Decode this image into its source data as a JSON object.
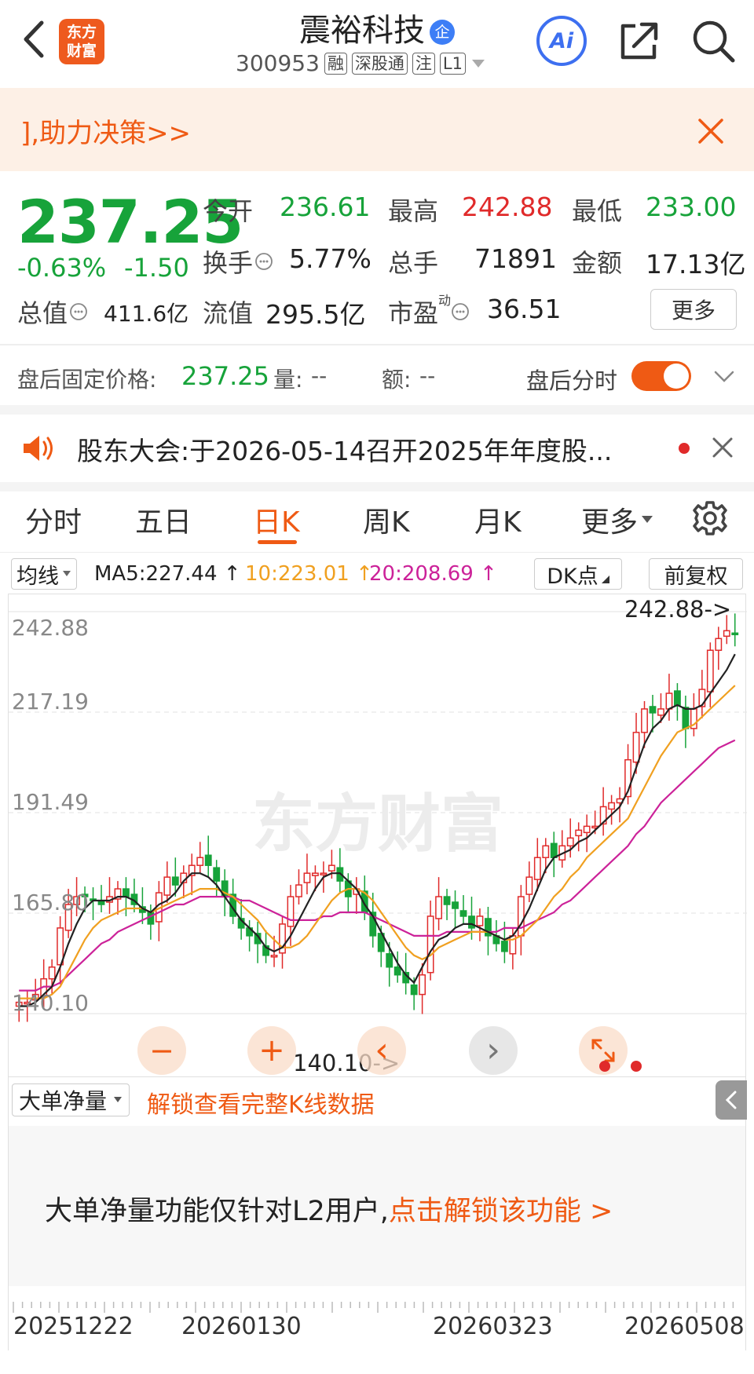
{
  "header": {
    "logo_text_line1": "东方",
    "logo_text_line2": "财富",
    "stock_name": "震裕科技",
    "name_badge": "企",
    "stock_code": "300953",
    "tags": [
      "融",
      "深股通",
      "注",
      "L1"
    ],
    "ai_label": "Ai"
  },
  "banner": {
    "text": "],助力决策>>"
  },
  "quote": {
    "price": "237.25",
    "change_pct": "-0.63%",
    "change_abs": "-1.50",
    "open_label": "今开",
    "open_value": "236.61",
    "high_label": "最高",
    "high_value": "242.88",
    "low_label": "最低",
    "low_value": "233.00",
    "turnover_label": "换手",
    "turnover_value": "5.77%",
    "volume_label": "总手",
    "volume_value": "71891",
    "amount_label": "金额",
    "amount_value": "17.13亿",
    "mktcap_label": "总值",
    "mktcap_value": "411.6亿",
    "float_label": "流值",
    "float_value": "295.5亿",
    "pe_label": "市盈",
    "pe_sup": "动",
    "pe_value": "36.51",
    "more_button": "更多"
  },
  "after_hours": {
    "label": "盘后固定价格:",
    "price": "237.25",
    "vol_label": "量:",
    "vol_value": "--",
    "amt_label": "额:",
    "amt_value": "--",
    "toggle_label": "盘后分时",
    "toggle_on": true
  },
  "notice": {
    "text": "股东大会:于2026-05-14召开2025年年度股..."
  },
  "tabs": {
    "items": [
      "分时",
      "五日",
      "日K",
      "周K",
      "月K",
      "更多"
    ],
    "active": "日K"
  },
  "ma_bar": {
    "dropdown": "均线",
    "ma5": "MA5:227.44 ↑",
    "ma10": "10:223.01 ↑",
    "ma20": "20:208.69 ↑",
    "dk_button": "DK点",
    "adjust_button": "前复权"
  },
  "colors": {
    "up": "#e02a2a",
    "down": "#17a33a",
    "ma5": "#222222",
    "ma10": "#f0a020",
    "ma20": "#cc2299",
    "accent": "#ef5a14"
  },
  "chart_data": {
    "type": "candlestick",
    "y_ticks": [
      "242.88",
      "217.19",
      "191.49",
      "165.80",
      "140.10"
    ],
    "ylim": [
      140.1,
      242.88
    ],
    "max_label": "242.88->",
    "min_label": "140.10->",
    "x_ticks": [
      "20251222",
      "20260130",
      "20260323",
      "20260508"
    ],
    "watermark": "东方财富",
    "close": [
      143,
      143,
      145,
      149,
      152,
      162,
      168,
      170,
      170,
      169,
      168,
      170,
      172,
      170,
      168,
      166,
      163,
      171,
      175,
      173,
      176,
      178,
      180,
      178,
      174,
      170,
      165,
      162,
      160,
      158,
      155,
      155,
      163,
      170,
      173,
      176,
      176,
      176,
      178,
      174,
      170,
      172,
      166,
      160,
      156,
      152,
      150,
      148,
      145,
      150,
      165,
      170,
      168,
      167,
      165,
      162,
      165,
      160,
      158,
      156,
      160,
      170,
      175,
      180,
      183,
      180,
      183,
      185,
      187,
      188,
      188,
      193,
      194,
      195,
      205,
      212,
      218,
      217,
      218,
      222,
      219,
      213,
      218,
      223,
      233,
      236,
      238,
      237
    ],
    "ma5": [
      142,
      142,
      143,
      145,
      147,
      152,
      158,
      163,
      167,
      169,
      169,
      169,
      170,
      170,
      169,
      167,
      166,
      168,
      169,
      171,
      174,
      176,
      176,
      175,
      173,
      170,
      167,
      164,
      162,
      160,
      157,
      156,
      157,
      160,
      164,
      168,
      172,
      175,
      176,
      176,
      174,
      172,
      168,
      165,
      161,
      157,
      153,
      150,
      148,
      152,
      156,
      159,
      160,
      162,
      163,
      163,
      162,
      161,
      160,
      159,
      160,
      163,
      167,
      172,
      177,
      180,
      181,
      182,
      184,
      185,
      187,
      189,
      191,
      193,
      197,
      203,
      209,
      213,
      215,
      218,
      219,
      218,
      218,
      219,
      222,
      225,
      228,
      232
    ],
    "ma10": [
      144,
      144,
      144,
      144,
      145,
      147,
      151,
      155,
      159,
      162,
      164,
      165,
      166,
      167,
      167,
      167,
      166,
      167,
      168,
      169,
      170,
      171,
      172,
      172,
      172,
      171,
      170,
      168,
      166,
      164,
      161,
      159,
      157,
      157,
      158,
      160,
      163,
      166,
      169,
      171,
      172,
      172,
      171,
      169,
      166,
      163,
      160,
      157,
      155,
      154,
      155,
      157,
      158,
      159,
      160,
      161,
      161,
      161,
      160,
      159,
      159,
      160,
      162,
      164,
      167,
      170,
      172,
      175,
      177,
      180,
      182,
      184,
      186,
      188,
      190,
      194,
      198,
      202,
      206,
      209,
      212,
      213,
      214,
      216,
      218,
      220,
      222,
      224
    ],
    "ma20": [
      146,
      146,
      146,
      147,
      147,
      148,
      150,
      152,
      154,
      156,
      158,
      159,
      161,
      162,
      163,
      164,
      165,
      166,
      167,
      168,
      168,
      169,
      170,
      170,
      170,
      170,
      170,
      169,
      169,
      168,
      167,
      166,
      165,
      164,
      164,
      164,
      164,
      165,
      165,
      166,
      166,
      166,
      166,
      165,
      164,
      163,
      162,
      161,
      160,
      160,
      160,
      160,
      161,
      161,
      161,
      161,
      161,
      161,
      161,
      162,
      162,
      162,
      163,
      164,
      165,
      166,
      168,
      169,
      171,
      173,
      175,
      177,
      179,
      181,
      183,
      186,
      188,
      191,
      194,
      196,
      198,
      200,
      202,
      204,
      206,
      208,
      209,
      210
    ]
  },
  "chart_controls": {
    "zoom_out": "−",
    "zoom_in": "+",
    "prev": "‹",
    "next": "›"
  },
  "indicator": {
    "dropdown": "大单净量",
    "unlock_link": "解锁查看完整K线数据",
    "message_prefix": "大单净量功能仅针对L2用户,",
    "message_action": "点击解锁该功能 >"
  }
}
